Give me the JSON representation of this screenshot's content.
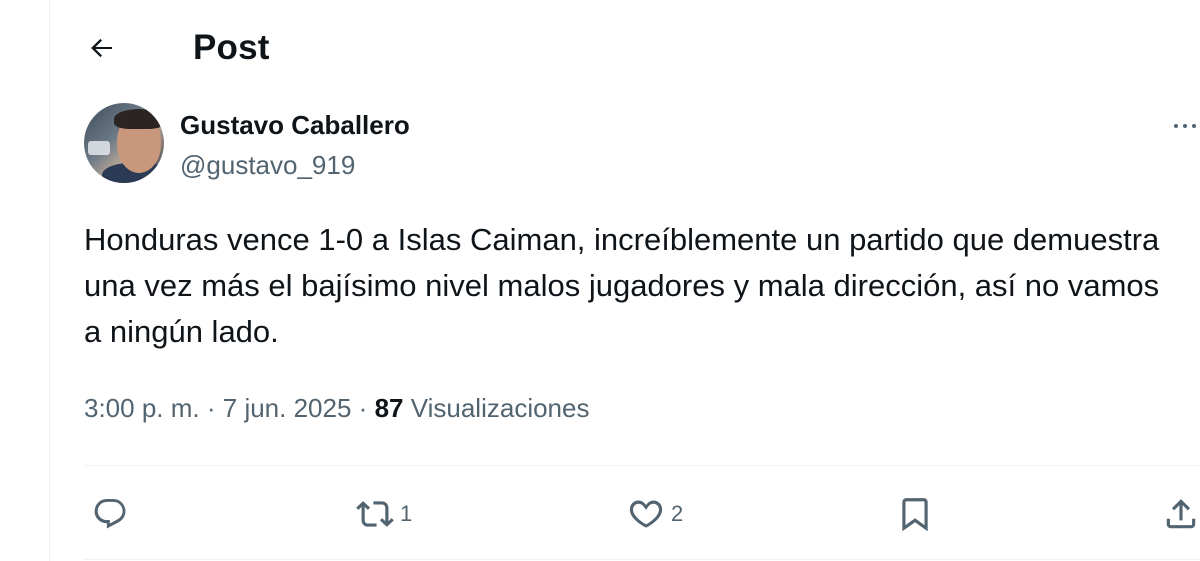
{
  "header": {
    "title": "Post",
    "back_icon": "arrow-left-icon"
  },
  "author": {
    "name": "Gustavo Caballero",
    "handle": "@gustavo_919"
  },
  "post": {
    "text": "Honduras vence 1-0 a Islas Caiman, increíblemente un partido que demuestra una vez más el bajísimo nivel malos jugadores y mala dirección, así no vamos a ningún lado.",
    "time": "3:00 p. m.",
    "separator": "·",
    "date": "7 jun. 2025",
    "views_count": "87",
    "views_label": "Visualizaciones"
  },
  "actions": {
    "reply": {
      "icon": "reply-icon",
      "count": ""
    },
    "repost": {
      "icon": "repost-icon",
      "count": "1"
    },
    "like": {
      "icon": "heart-icon",
      "count": "2"
    },
    "bookmark": {
      "icon": "bookmark-icon"
    },
    "share": {
      "icon": "share-icon"
    }
  },
  "colors": {
    "text_primary": "#0f1419",
    "text_secondary": "#536471",
    "divider": "#eff3f4"
  }
}
